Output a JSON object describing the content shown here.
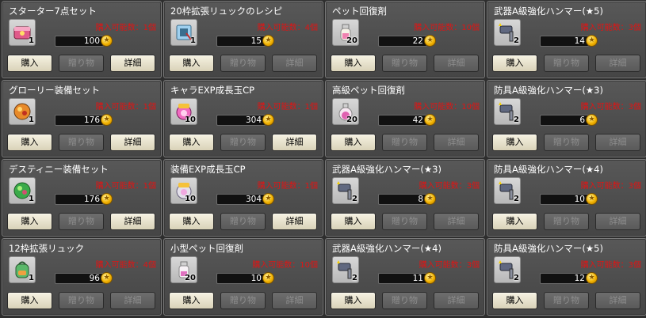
{
  "buttons": {
    "buy": "購入",
    "gift": "贈り物",
    "detail": "詳細"
  },
  "items": [
    {
      "name": "スターター7点セット",
      "limit": "購入可能数：1個",
      "count": "1",
      "price": "100",
      "icon": "starter-box-icon",
      "detail_enabled": true
    },
    {
      "name": "20枠拡張リュックのレシピ",
      "limit": "購入可能数：4個",
      "count": "1",
      "price": "15",
      "icon": "recipe-scroll-icon",
      "detail_enabled": false
    },
    {
      "name": "ペット回復剤",
      "limit": "購入可能数：10個",
      "count": "20",
      "price": "22",
      "icon": "pet-potion-icon",
      "detail_enabled": false
    },
    {
      "name": "武器A級強化ハンマー(★5)",
      "limit": "購入可能数：3個",
      "count": "2",
      "price": "14",
      "icon": "hammer-icon",
      "detail_enabled": false
    },
    {
      "name": "グローリー装備セット",
      "limit": "購入可能数：1個",
      "count": "1",
      "price": "176",
      "icon": "glory-orb-icon",
      "detail_enabled": true
    },
    {
      "name": "キャラEXP成長玉CP",
      "limit": "購入可能数：1個",
      "count": "10",
      "price": "304",
      "icon": "exp-orb-icon",
      "detail_enabled": true
    },
    {
      "name": "高級ペット回復剤",
      "limit": "購入可能数：10個",
      "count": "20",
      "price": "42",
      "icon": "premium-pet-potion-icon",
      "detail_enabled": false
    },
    {
      "name": "防具A級強化ハンマー(★3)",
      "limit": "購入可能数：3個",
      "count": "2",
      "price": "6",
      "icon": "hammer-icon",
      "detail_enabled": false
    },
    {
      "name": "デスティニー装備セット",
      "limit": "購入可能数：1個",
      "count": "1",
      "price": "176",
      "icon": "destiny-orb-icon",
      "detail_enabled": true
    },
    {
      "name": "装備EXP成長玉CP",
      "limit": "購入可能数：1個",
      "count": "10",
      "price": "304",
      "icon": "wp-orb-icon",
      "detail_enabled": true
    },
    {
      "name": "武器A級強化ハンマー(★3)",
      "limit": "購入可能数：3個",
      "count": "2",
      "price": "8",
      "icon": "hammer-icon",
      "detail_enabled": false
    },
    {
      "name": "防具A級強化ハンマー(★4)",
      "limit": "購入可能数：3個",
      "count": "2",
      "price": "10",
      "icon": "hammer-icon",
      "detail_enabled": false
    },
    {
      "name": "12枠拡張リュック",
      "limit": "購入可能数：4個",
      "count": "1",
      "price": "96",
      "icon": "backpack-icon",
      "detail_enabled": false
    },
    {
      "name": "小型ペット回復剤",
      "limit": "購入可能数：10個",
      "count": "20",
      "price": "10",
      "icon": "small-pet-potion-icon",
      "detail_enabled": false
    },
    {
      "name": "武器A級強化ハンマー(★4)",
      "limit": "購入可能数：3個",
      "count": "2",
      "price": "11",
      "icon": "hammer-icon",
      "detail_enabled": false
    },
    {
      "name": "防具A級強化ハンマー(★5)",
      "limit": "購入可能数：3個",
      "count": "2",
      "price": "12",
      "icon": "hammer-icon",
      "detail_enabled": false
    }
  ],
  "colors": {
    "limit_text": "#e01414",
    "panel": "#4e4e4e",
    "button_active": "#ece6cc",
    "button_disabled": "#626262"
  }
}
